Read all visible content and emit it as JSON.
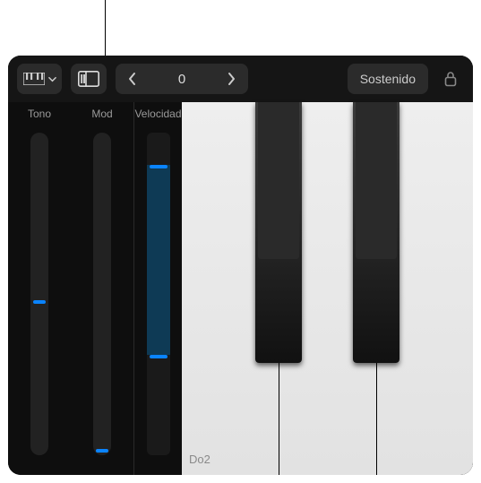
{
  "toolbar": {
    "keyboard_mode_icon": "keyboard",
    "controls_toggle_icon": "controls-panel",
    "octave_value": "0",
    "sustain_label": "Sostenido"
  },
  "controls": {
    "pitch_label": "Tono",
    "mod_label": "Mod",
    "velocity_label": "Velocidad",
    "pitch_position_pct": 52,
    "mod_position_pct": 98,
    "velocity_low_pct": 69,
    "velocity_high_pct": 10
  },
  "keyboard": {
    "whites": 3,
    "blacks": [
      {
        "after_white": 0,
        "width_pct": 16
      },
      {
        "after_white": 1,
        "width_pct": 16
      }
    ],
    "note_label": "Do2"
  },
  "colors": {
    "accent": "#0a84ff",
    "panel": "#2b2b2b",
    "track": "#222222",
    "vel_fill": "#0e3a55"
  }
}
